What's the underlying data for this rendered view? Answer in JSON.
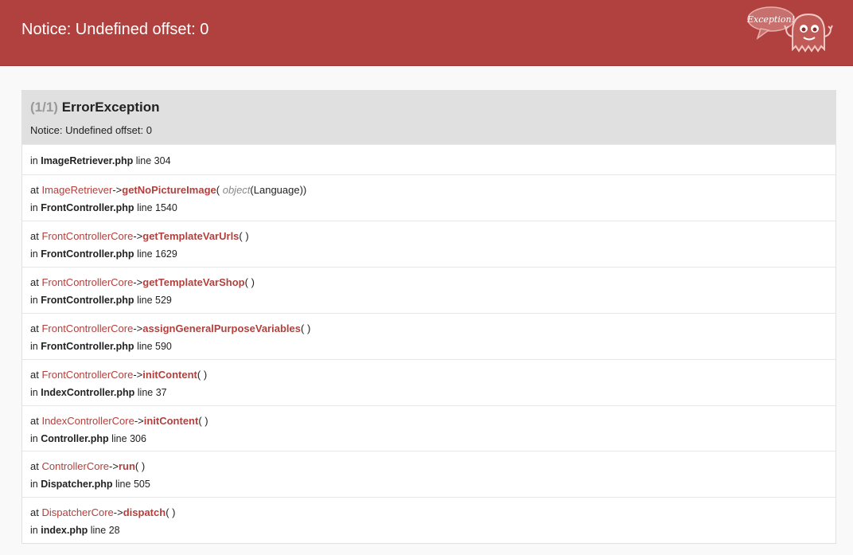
{
  "header": {
    "title": "Notice: Undefined offset: 0",
    "logo_text": "Exception!"
  },
  "exception": {
    "count": "(1/1)",
    "class": "ErrorException",
    "message": "Notice: Undefined offset: 0"
  },
  "trace": {
    "first": {
      "in": "in",
      "file": "ImageRetriever.php",
      "line_word": "line",
      "line": "304"
    },
    "frames": [
      {
        "at": "at",
        "class": "ImageRetriever",
        "arrow": "->",
        "method": "getNoPictureImage",
        "open": "(",
        "arg_type": "object",
        "arg_value": "(Language)",
        "close": ")",
        "in": "in",
        "file": "FrontController.php",
        "line_word": "line",
        "line": "1540"
      },
      {
        "at": "at",
        "class": "FrontControllerCore",
        "arrow": "->",
        "method": "getTemplateVarUrls",
        "open": "(",
        "arg_type": "",
        "arg_value": "",
        "close": ")",
        "in": "in",
        "file": "FrontController.php",
        "line_word": "line",
        "line": "1629"
      },
      {
        "at": "at",
        "class": "FrontControllerCore",
        "arrow": "->",
        "method": "getTemplateVarShop",
        "open": "(",
        "arg_type": "",
        "arg_value": "",
        "close": ")",
        "in": "in",
        "file": "FrontController.php",
        "line_word": "line",
        "line": "529"
      },
      {
        "at": "at",
        "class": "FrontControllerCore",
        "arrow": "->",
        "method": "assignGeneralPurposeVariables",
        "open": "(",
        "arg_type": "",
        "arg_value": "",
        "close": ")",
        "in": "in",
        "file": "FrontController.php",
        "line_word": "line",
        "line": "590"
      },
      {
        "at": "at",
        "class": "FrontControllerCore",
        "arrow": "->",
        "method": "initContent",
        "open": "(",
        "arg_type": "",
        "arg_value": "",
        "close": ")",
        "in": "in",
        "file": "IndexController.php",
        "line_word": "line",
        "line": "37"
      },
      {
        "at": "at",
        "class": "IndexControllerCore",
        "arrow": "->",
        "method": "initContent",
        "open": "(",
        "arg_type": "",
        "arg_value": "",
        "close": ")",
        "in": "in",
        "file": "Controller.php",
        "line_word": "line",
        "line": "306"
      },
      {
        "at": "at",
        "class": "ControllerCore",
        "arrow": "->",
        "method": "run",
        "open": "(",
        "arg_type": "",
        "arg_value": "",
        "close": ")",
        "in": "in",
        "file": "Dispatcher.php",
        "line_word": "line",
        "line": "505"
      },
      {
        "at": "at",
        "class": "DispatcherCore",
        "arrow": "->",
        "method": "dispatch",
        "open": "(",
        "arg_type": "",
        "arg_value": "",
        "close": ")",
        "in": "in",
        "file": "index.php",
        "line_word": "line",
        "line": "28"
      }
    ]
  },
  "colors": {
    "header_bg": "#b0413e",
    "accent": "#b0413e",
    "panel_head_bg": "#e0e0e0",
    "page_bg": "#f9f9f9"
  }
}
